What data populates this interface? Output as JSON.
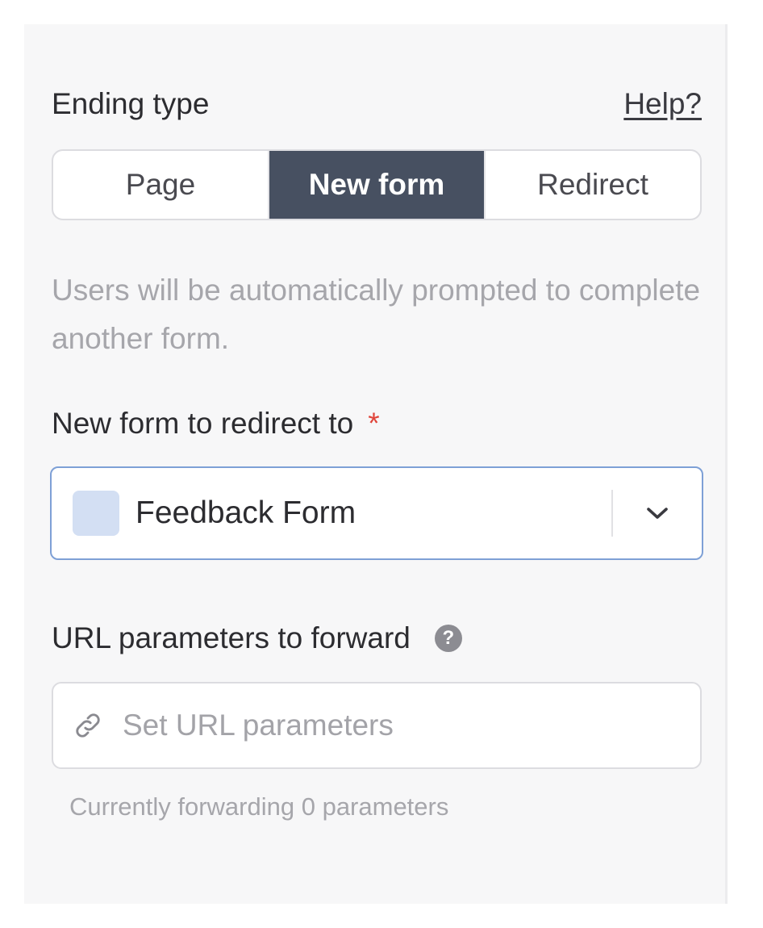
{
  "ending_type": {
    "label": "Ending type",
    "help_link": "Help?",
    "options": [
      "Page",
      "New form",
      "Redirect"
    ],
    "selected": "New form"
  },
  "description": "Users will be automatically prompted to complete another form.",
  "new_form": {
    "label": "New form to redirect to",
    "required_marker": "*",
    "selected_value": "Feedback Form",
    "swatch_color": "#d3dff3"
  },
  "url_params": {
    "label": "URL parameters to forward",
    "help_icon": "question-circle-icon",
    "placeholder": "Set URL parameters",
    "value": "",
    "status": "Currently forwarding 0 parameters"
  },
  "colors": {
    "active_segment": "#475061",
    "focus_border": "#7ea0d6",
    "required": "#e0463c"
  }
}
